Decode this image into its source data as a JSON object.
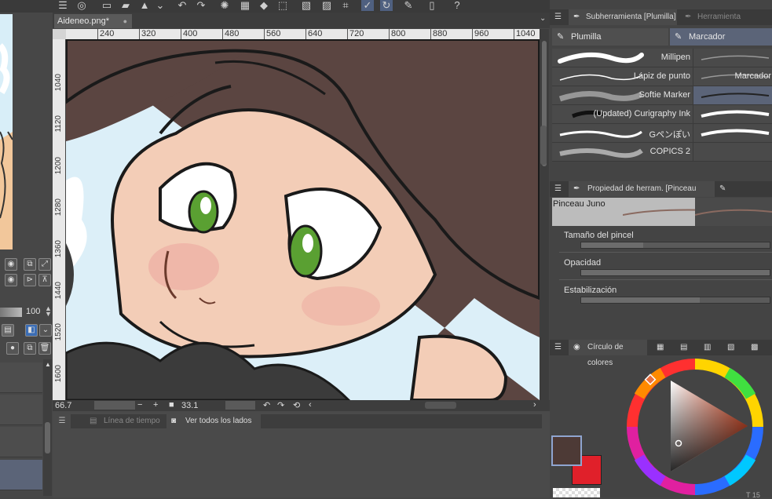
{
  "document": {
    "tab_title": "Aideneo.png*",
    "tab_dot": "●"
  },
  "ruler": {
    "top_ticks": [
      "240",
      "320",
      "400",
      "480",
      "560",
      "640",
      "720",
      "800",
      "880",
      "960",
      "1040"
    ],
    "left_ticks": [
      "1040",
      "1120",
      "1200",
      "1280",
      "1360",
      "1440",
      "1520",
      "1600"
    ]
  },
  "status": {
    "zoom": "66.7",
    "angle": "33.1",
    "minus": "−",
    "plus": "+"
  },
  "left_panel": {
    "opacity_value": "100"
  },
  "bottom_panel": {
    "tabs": [
      {
        "label": "Línea de tiempo"
      },
      {
        "label": "Ver todos los lados"
      }
    ]
  },
  "sub_tool": {
    "header": "Subherramienta [Plumilla]",
    "header2": "Herramienta",
    "tabs": [
      {
        "label": "Plumilla",
        "active": false
      },
      {
        "label": "Marcador",
        "active": true
      }
    ],
    "brushes": [
      {
        "left": "Millipen",
        "right": ""
      },
      {
        "left": "Lápiz de punto",
        "right": "Marcador"
      },
      {
        "left": "Softie Marker",
        "right": ""
      },
      {
        "left": "(Updated) Curigraphy Ink",
        "right": ""
      },
      {
        "left": "Gペンぽい",
        "right": ""
      },
      {
        "left": "COPICS 2",
        "right": ""
      }
    ]
  },
  "tool_property": {
    "header": "Propiedad de herram. [Pinceau Juno]",
    "brush_name": "Pinceau Juno",
    "properties": [
      {
        "label": "Tamaño del pincel",
        "level": 0.33
      },
      {
        "label": "Opacidad",
        "level": 1.0
      },
      {
        "label": "Estabilización",
        "level": 0.63
      }
    ]
  },
  "color": {
    "header": "Círculo de colores",
    "main_color": "#4d3a36",
    "sub_color": "#e0202a",
    "footer_text": "T 15"
  }
}
